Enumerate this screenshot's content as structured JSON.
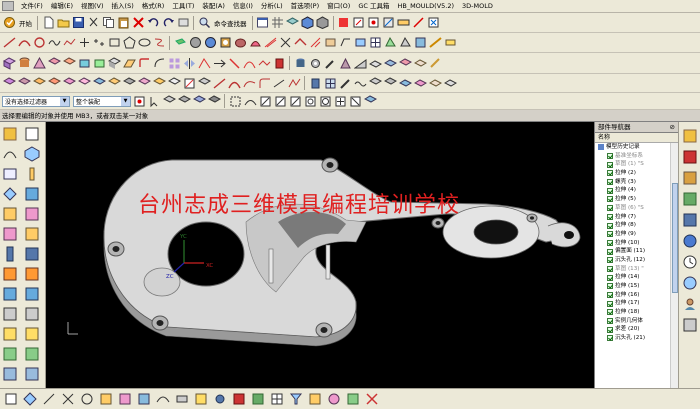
{
  "menu": {
    "items": [
      "文件(F)",
      "编辑(E)",
      "视图(V)",
      "插入(S)",
      "格式(R)",
      "工具(T)",
      "装配(A)",
      "信息(I)",
      "分析(L)",
      "首选项(P)",
      "窗口(O)",
      "GC 工具箱",
      "HB_MOULD(V5.2)",
      "3D-MOLD"
    ]
  },
  "toolbar1": {
    "start_label": "开始",
    "command_finder_label": "命令查找器"
  },
  "toolbar4": {
    "filter_value": "没有选择过滤器",
    "assembly_value": "整个装配"
  },
  "status": {
    "prompt": "选择要编辑的对象并使用 MB3，或者双击某一对象"
  },
  "viewport": {
    "watermark": "台州志成三维模具编程培训学校",
    "axis_labels": {
      "x": "XC",
      "y": "YC",
      "z": "ZC"
    },
    "colors": {
      "background": "#000000",
      "part_fill": "#d9d9d9",
      "part_shade": "#9a9a9a",
      "watermark": "#e02020"
    }
  },
  "part_navigator": {
    "title": "部件导航器",
    "column_header": "名称",
    "tree": [
      {
        "label": "模型历史记录",
        "kind": "folder",
        "dim": false
      },
      {
        "label": "基准坐标系",
        "kind": "item",
        "dim": true
      },
      {
        "label": "草图 (1) \"S",
        "kind": "item",
        "dim": true
      },
      {
        "label": "拉伸 (2)",
        "kind": "item",
        "dim": false
      },
      {
        "label": "螺壳 (3)",
        "kind": "item",
        "dim": false
      },
      {
        "label": "拉伸 (4)",
        "kind": "item",
        "dim": false
      },
      {
        "label": "拉伸 (5)",
        "kind": "item",
        "dim": false
      },
      {
        "label": "草图 (6) \"S",
        "kind": "item",
        "dim": true
      },
      {
        "label": "拉伸 (7)",
        "kind": "item",
        "dim": false
      },
      {
        "label": "拉伸 (8)",
        "kind": "item",
        "dim": false
      },
      {
        "label": "拉伸 (9)",
        "kind": "item",
        "dim": false
      },
      {
        "label": "拉伸 (10)",
        "kind": "item",
        "dim": false
      },
      {
        "label": "偏置面 (11)",
        "kind": "item",
        "dim": false
      },
      {
        "label": "沉头孔 (12)",
        "kind": "item",
        "dim": false
      },
      {
        "label": "草图 (13) \"",
        "kind": "item",
        "dim": true
      },
      {
        "label": "拉伸 (14)",
        "kind": "item",
        "dim": false
      },
      {
        "label": "拉伸 (15)",
        "kind": "item",
        "dim": false
      },
      {
        "label": "拉伸 (16)",
        "kind": "item",
        "dim": false
      },
      {
        "label": "拉伸 (17)",
        "kind": "item",
        "dim": false
      },
      {
        "label": "拉伸 (18)",
        "kind": "item",
        "dim": false
      },
      {
        "label": "实例几何体",
        "kind": "item",
        "dim": false
      },
      {
        "label": "求差 (20)",
        "kind": "item",
        "dim": false
      },
      {
        "label": "沉头孔 (21)",
        "kind": "item",
        "dim": false
      }
    ]
  }
}
